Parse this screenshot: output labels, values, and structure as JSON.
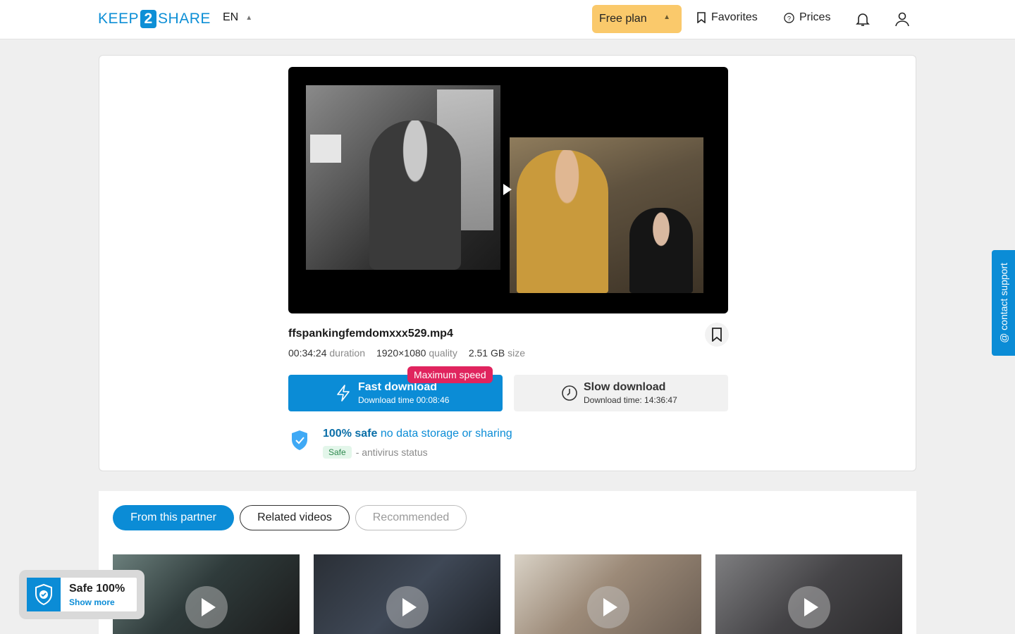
{
  "header": {
    "logo_left": "KEEP",
    "logo_num": "2",
    "logo_right": "SHARE",
    "lang": "EN",
    "plan_label": "Free plan",
    "favorites_label": "Favorites",
    "prices_label": "Prices"
  },
  "file": {
    "name": "ffspankingfemdomxxx529.mp4",
    "duration": "00:34:24",
    "duration_label": "duration",
    "resolution": "1920×1080",
    "resolution_label": "quality",
    "size": "2.51 GB",
    "size_label": "size"
  },
  "download": {
    "fast_title": "Fast download",
    "fast_time": "Download time 00:08:46",
    "badge": "Maximum speed",
    "slow_title": "Slow download",
    "slow_time": "Download time: 14:36:47"
  },
  "safety": {
    "bold": "100% safe",
    "text": "no data storage or sharing",
    "badge": "Safe",
    "status": "- antivirus status"
  },
  "tabs": {
    "partner": "From this partner",
    "related": "Related videos",
    "recommended": "Recommended"
  },
  "safe_widget": {
    "title": "Safe 100%",
    "link": "Show more"
  },
  "contact": {
    "label": "@ contact support"
  },
  "colors": {
    "accent": "#0b8cd6",
    "plan": "#fac96b",
    "badge": "#e0245e"
  }
}
